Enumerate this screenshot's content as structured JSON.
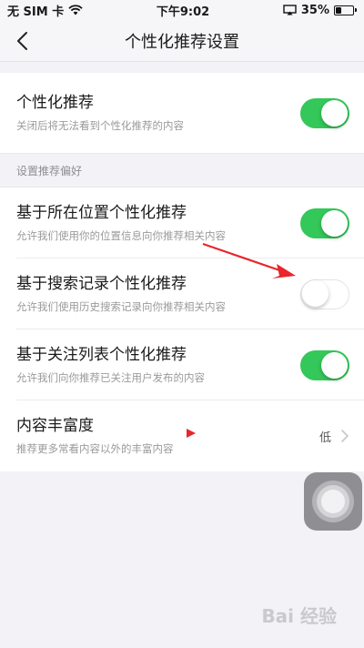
{
  "status_bar": {
    "carrier": "无 SIM 卡",
    "time": "下午9:02",
    "battery": "35%",
    "battery_level": 0.35
  },
  "nav": {
    "title": "个性化推荐设置",
    "back_icon": "chevron-left-icon"
  },
  "main_setting": {
    "title": "个性化推荐",
    "subtitle": "关闭后将无法看到个性化推荐的内容",
    "enabled": true
  },
  "section_header": "设置推荐偏好",
  "preferences": [
    {
      "title": "基于所在位置个性化推荐",
      "subtitle": "允许我们使用你的位置信息向你推荐相关内容",
      "enabled": true
    },
    {
      "title": "基于搜索记录个性化推荐",
      "subtitle": "允许我们使用历史搜索记录向你推荐相关内容",
      "enabled": false
    },
    {
      "title": "基于关注列表个性化推荐",
      "subtitle": "允许我们向你推荐已关注用户发布的内容",
      "enabled": true
    }
  ],
  "richness": {
    "title": "内容丰富度",
    "subtitle": "推荐更多常看内容以外的丰富内容",
    "value": "低"
  },
  "watermark": "Bai 经验",
  "colors": {
    "toggle_on": "#34c759",
    "annotation_arrow": "#e8262b"
  }
}
